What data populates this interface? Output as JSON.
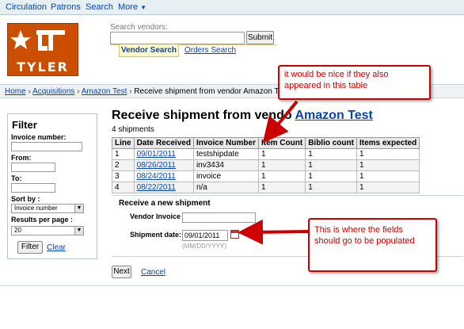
{
  "nav": {
    "items": [
      "Circulation",
      "Patrons",
      "Search",
      "More"
    ],
    "more_caret": "▼"
  },
  "logo": {
    "word": "TYLER",
    "mark": "UT"
  },
  "search": {
    "label": "Search vendors:",
    "value": "",
    "button": "Submit",
    "tabs": [
      "Vendor Search",
      "Orders Search"
    ]
  },
  "breadcrumb": {
    "home": "Home",
    "acquisitions": "Acquisitions",
    "vendor": "Amazon Test",
    "current": "Receive shipment from vendor Amazon Test",
    "sep": "›"
  },
  "filter": {
    "title": "Filter",
    "invoice_label": "Invoice number:",
    "from_label": "From:",
    "to_label": "To:",
    "sort_label": "Sort by :",
    "sort_value": "Invoice number",
    "rpp_label": "Results per page :",
    "rpp_value": "20",
    "filter_button": "Filter",
    "clear_link": "Clear"
  },
  "main": {
    "title_prefix": "Receive shipment from vendo",
    "title_vendor": "Amazon Test",
    "count": "4 shipments",
    "columns": [
      "Line",
      "Date Received",
      "Invoice Number",
      "Item Count",
      "Biblio count",
      "Items expected"
    ],
    "rows": [
      {
        "line": "1",
        "date": "09/01/2011",
        "invoice": "testshipdate",
        "items": "1",
        "biblio": "1",
        "expected": "1"
      },
      {
        "line": "2",
        "date": "08/26/2011",
        "invoice": "inv3434",
        "items": "1",
        "biblio": "1",
        "expected": "1"
      },
      {
        "line": "3",
        "date": "08/24/2011",
        "invoice": "invoice",
        "items": "1",
        "biblio": "1",
        "expected": "1"
      },
      {
        "line": "4",
        "date": "08/22/2011",
        "invoice": "n/a",
        "items": "1",
        "biblio": "1",
        "expected": "1"
      }
    ]
  },
  "receive": {
    "title": "Receive a new shipment",
    "vendor_invoice_label": "Vendor Invoice",
    "vendor_invoice_value": "",
    "shipment_date_label": "Shipment date:",
    "shipment_date_value": "09/01/2011",
    "date_hint": "(MM/DD/YYYY)"
  },
  "actions": {
    "next": "Next",
    "cancel": "Cancel"
  },
  "annotations": {
    "top": "it would be nice if they also appeared in this table",
    "bottom": "This is where the fields should go to be populated"
  },
  "colors": {
    "link": "#0645ad",
    "logo": "#cc4e00",
    "annotation": "#cc0000"
  }
}
